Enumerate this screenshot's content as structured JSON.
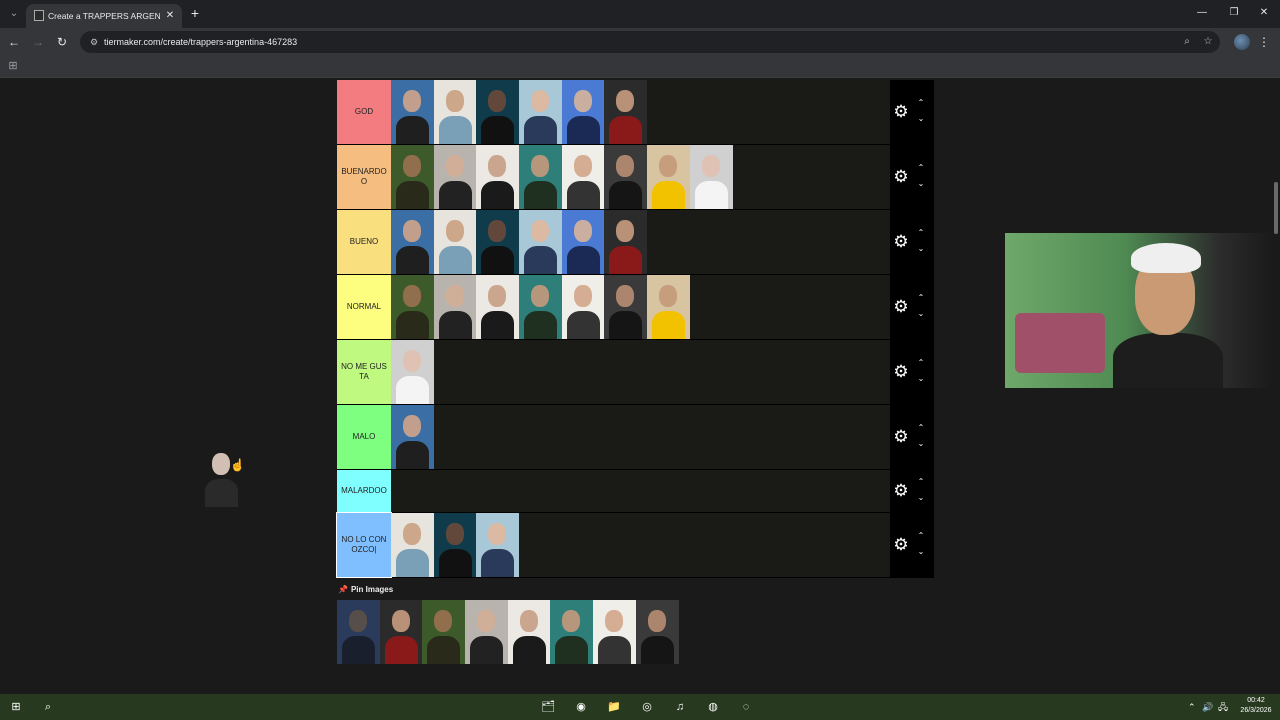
{
  "browser": {
    "tab_title": "Create a TRAPPERS ARGENTINA",
    "tab_close": "✕",
    "new_tab": "+",
    "tab_menu": "⌄",
    "url": "tiermaker.com/create/trappers-argentina-467283",
    "window_minimize": "—",
    "window_restore": "❐",
    "window_close": "✕",
    "back": "←",
    "forward": "→",
    "reload": "↻",
    "site_info": "⚙",
    "zoom": "⌕",
    "bookmark": "☆",
    "menu": "⋮",
    "apps": "⊞"
  },
  "tiers": [
    {
      "label": "GOD",
      "color": "#f27c80",
      "count": 6
    },
    {
      "label": "BUENARDOO",
      "color": "#f5be80",
      "count": 8
    },
    {
      "label": "BUENO",
      "color": "#fadf7f",
      "count": 6
    },
    {
      "label": "NORMAL",
      "color": "#fdfe7f",
      "count": 7
    },
    {
      "label": "NO ME GUSTA",
      "color": "#bff980",
      "count": 1
    },
    {
      "label": "MALO",
      "color": "#7eff7f",
      "count": 1
    },
    {
      "label": "MALARDOO",
      "color": "#7fffff",
      "count": 0
    },
    {
      "label": "NO LO CONOZCO|",
      "color": "#7fbfff",
      "count": 3
    }
  ],
  "controls": {
    "gear": "⚙",
    "up": "⌃",
    "down": "⌄"
  },
  "pin": {
    "icon": "📌",
    "label": "Pin Images"
  },
  "pool_count": 8,
  "cursor": "☝",
  "taskbar": {
    "start": "⊞",
    "search": "⌕",
    "apps": [
      "🗂",
      "◉",
      "📁",
      "◎",
      "♫",
      "◍",
      "◌"
    ],
    "tray_caret": "⌃",
    "tray_volume": "🔊",
    "tray_network": "🖧",
    "time": "00:42",
    "date": "26/3/2026"
  }
}
